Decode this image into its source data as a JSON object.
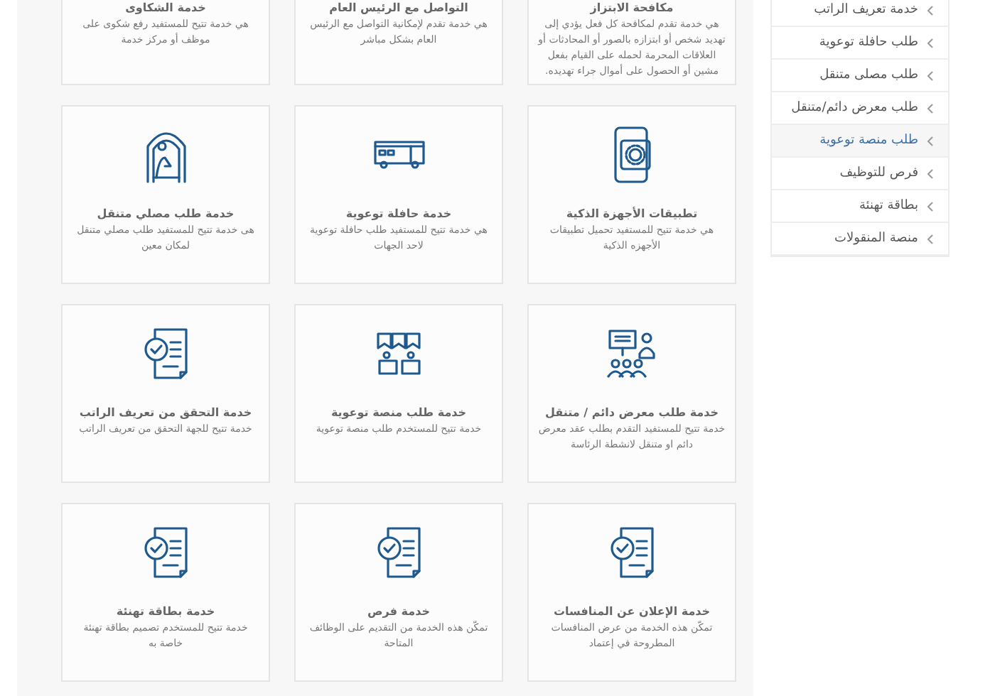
{
  "services_top": [
    {
      "title": "مكافحة الابتزاز",
      "description": "هي خدمة تقدم لمكافحة كل فعل يؤدي إلى تهديد شخص أو ابتزازه بالصور أو المحادثات أو العلاقات المحرمة لحمله على القيام بفعل مشين أو الحصول على أموال جراء تهديده."
    },
    {
      "title": "التواصل مع الرئيس العام",
      "description": "هي خدمة تقدم لإمكانية التواصل مع الرئيس العام بشكل مباشر"
    },
    {
      "title": "خدمة الشكاوى",
      "description": "هي خدمة تتيح للمستفيد رفع شكوى على موظف أو مركز خدمة"
    }
  ],
  "services": [
    {
      "kind": "phone",
      "title": "تطبيقات الأجهزة الذكية",
      "description": "هي خدمة تتيح للمستفيد تحميل تطبيقات الأجهزه الذكية"
    },
    {
      "kind": "bus",
      "title": "خدمة حافلة توعوية",
      "description": "هي خدمة تتيح للمستفيد طلب حافلة توعوية لاحد الجهات"
    },
    {
      "kind": "mosque",
      "title": "خدمة طلب مصلي متنقل",
      "description": "هى خدمة تتيح للمستفيد طلب مصلي متنقل لمكان معين"
    },
    {
      "kind": "exhibition",
      "title": "خدمة طلب معرض دائم / متنقل",
      "description": "خدمة تتيح للمستفيد التقدم بطلب عقد معرض دائم او متنقل لانشطة الرئاسة"
    },
    {
      "kind": "platform",
      "title": "خدمة طلب منصة توعوية",
      "description": "خدمة تتيح للمستخدم طلب منصة توعوية"
    },
    {
      "kind": "document",
      "title": "خدمة التحقق من تعريف الراتب",
      "description": "خدمة تتيح للجهة التحقق من تعريف الراتب"
    },
    {
      "kind": "document",
      "title": "خدمة الإعلان عن المنافسات",
      "description": "تمكّن هذه الخدمة من عرض المنافسات المطروحة في إعتماد"
    },
    {
      "kind": "document",
      "title": "خدمة فرص",
      "description": "تمكّن هذه الخدمة من التقديم على الوظائف المتاحة"
    },
    {
      "kind": "document",
      "title": "خدمة بطاقة تهنئة",
      "description": "خدمة تتيح للمستخدم تصميم بطاقة تهنئة خاصة به"
    }
  ],
  "sidebar": {
    "items": [
      {
        "label": "خدمة تعريف الراتب",
        "selected": false
      },
      {
        "label": "طلب حافلة توعوية",
        "selected": false
      },
      {
        "label": "طلب مصلى متنقل",
        "selected": false
      },
      {
        "label": "طلب معرض دائم/متنقل",
        "selected": false
      },
      {
        "label": "طلب منصة توعوية",
        "selected": true
      },
      {
        "label": "فرص للتوظيف",
        "selected": false
      },
      {
        "label": "بطاقة تهنئة",
        "selected": false
      },
      {
        "label": "منصة المنقولات",
        "selected": false
      }
    ]
  }
}
